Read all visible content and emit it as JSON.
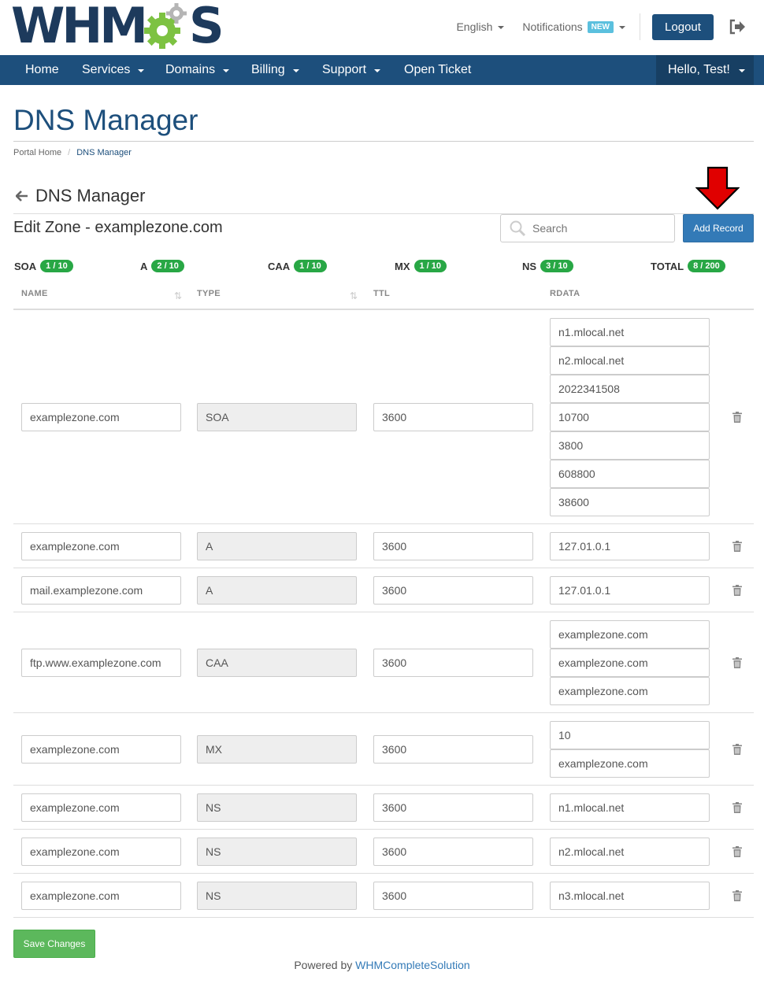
{
  "header": {
    "logo_left": "WHM",
    "logo_right": "S",
    "language": "English",
    "notifications": "Notifications",
    "notifications_badge": "NEW",
    "logout": "Logout"
  },
  "nav": {
    "items": [
      "Home",
      "Services",
      "Domains",
      "Billing",
      "Support",
      "Open Ticket"
    ],
    "user": "Hello, Test!"
  },
  "page": {
    "title": "DNS Manager",
    "breadcrumb": [
      "Portal Home",
      "DNS Manager"
    ],
    "subtitle": "DNS Manager",
    "zone_title": "Edit Zone - examplezone.com",
    "search_placeholder": "Search",
    "add_record": "Add Record"
  },
  "counters": [
    {
      "label": "SOA",
      "value": "1 / 10"
    },
    {
      "label": "A",
      "value": "2 / 10"
    },
    {
      "label": "CAA",
      "value": "1 / 10"
    },
    {
      "label": "MX",
      "value": "1 / 10"
    },
    {
      "label": "NS",
      "value": "3 / 10"
    },
    {
      "label": "TOTAL",
      "value": "8 / 200"
    }
  ],
  "columns": [
    "NAME",
    "TYPE",
    "TTL",
    "RDATA"
  ],
  "records": [
    {
      "name": "examplezone.com",
      "type": "SOA",
      "ttl": "3600",
      "rdata": [
        "n1.mlocal.net",
        "n2.mlocal.net",
        "2022341508",
        "10700",
        "3800",
        "608800",
        "38600"
      ]
    },
    {
      "name": "examplezone.com",
      "type": "A",
      "ttl": "3600",
      "rdata": [
        "127.01.0.1"
      ]
    },
    {
      "name": "mail.examplezone.com",
      "type": "A",
      "ttl": "3600",
      "rdata": [
        "127.01.0.1"
      ]
    },
    {
      "name": "ftp.www.examplezone.com",
      "type": "CAA",
      "ttl": "3600",
      "rdata": [
        "examplezone.com",
        "examplezone.com",
        "examplezone.com"
      ]
    },
    {
      "name": "examplezone.com",
      "type": "MX",
      "ttl": "3600",
      "rdata": [
        "10",
        "examplezone.com"
      ]
    },
    {
      "name": "examplezone.com",
      "type": "NS",
      "ttl": "3600",
      "rdata": [
        "n1.mlocal.net"
      ]
    },
    {
      "name": "examplezone.com",
      "type": "NS",
      "ttl": "3600",
      "rdata": [
        "n2.mlocal.net"
      ]
    },
    {
      "name": "examplezone.com",
      "type": "NS",
      "ttl": "3600",
      "rdata": [
        "n3.mlocal.net"
      ]
    }
  ],
  "save_changes": "Save Changes",
  "footer": {
    "prefix": "Powered by ",
    "link": "WHMCompleteSolution"
  },
  "colors": {
    "brand": "#1d4f7c",
    "badge": "#28a745",
    "primary": "#337ab7",
    "success": "#5cb85c",
    "arrow": "#e00000"
  }
}
